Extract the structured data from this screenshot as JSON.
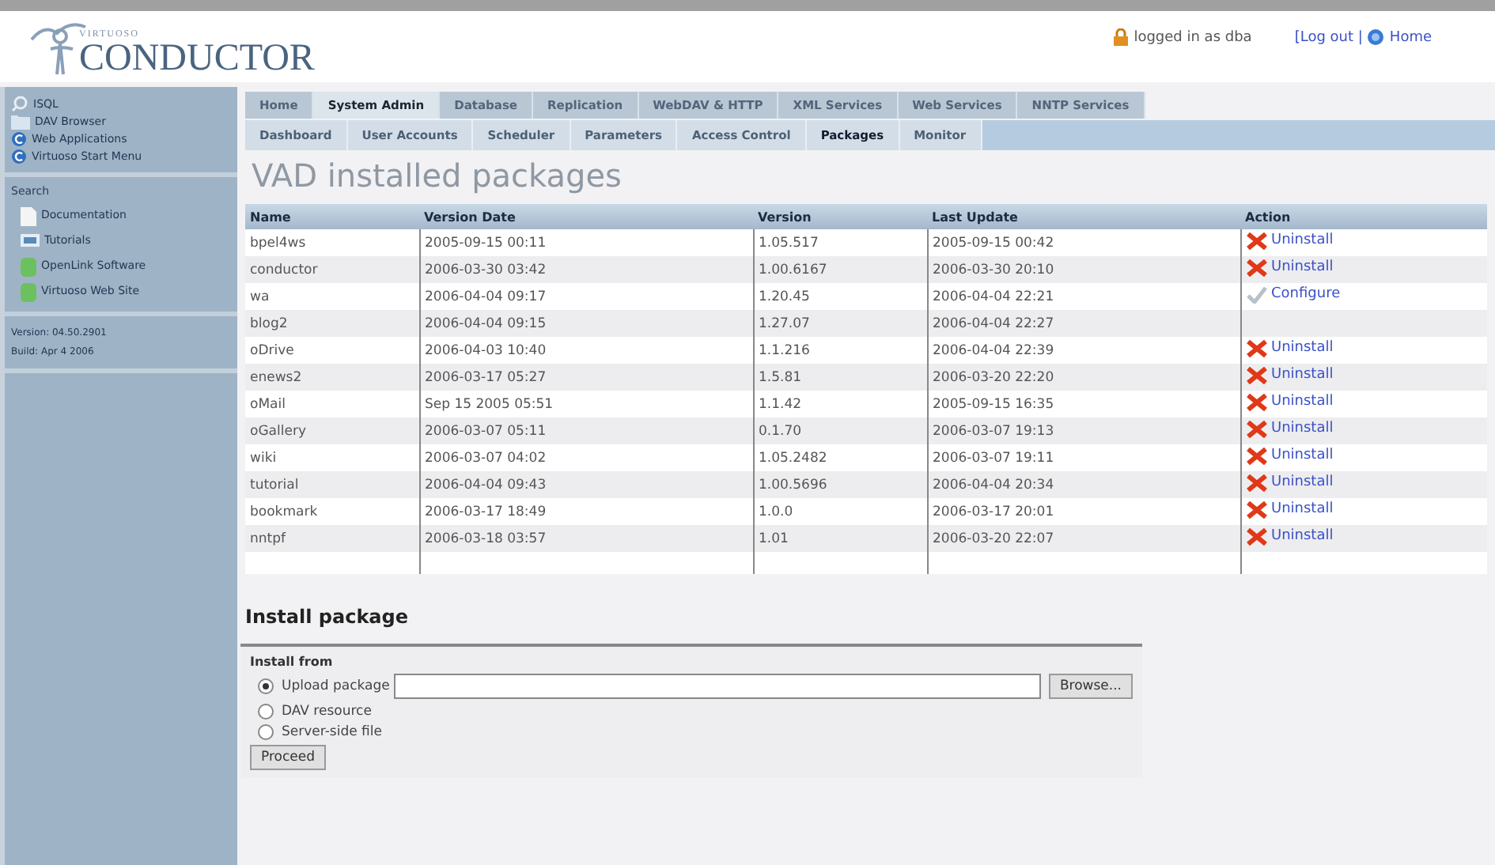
{
  "header": {
    "logo_small": "VIRTUOSO",
    "logo_big": "CONDUCTOR",
    "user": "logged in as dba",
    "logout": "[Log out |",
    "home": "Home"
  },
  "sidebar": {
    "groups": [
      {
        "items": [
          {
            "label": "ISQL",
            "kind": "isql"
          },
          {
            "label": "DAV Browser",
            "kind": "folder"
          },
          {
            "label": "Web Applications",
            "kind": "app"
          },
          {
            "label": "Virtuoso Start Menu",
            "kind": "app"
          }
        ]
      },
      {
        "title": "Search",
        "items": [
          {
            "label": "Documentation",
            "kind": "doc"
          },
          {
            "label": "Tutorials",
            "kind": "monitor"
          },
          {
            "label": "OpenLink Software",
            "kind": "site"
          },
          {
            "label": "Virtuoso Web Site",
            "kind": "site"
          }
        ]
      },
      {
        "info": [
          "Version: 04.50.2901",
          "Build: Apr 4 2006"
        ]
      }
    ]
  },
  "tabs": [
    {
      "label": "Home",
      "selected": false
    },
    {
      "label": "System Admin",
      "selected": true
    },
    {
      "label": "Database",
      "selected": false
    },
    {
      "label": "Replication",
      "selected": false
    },
    {
      "label": "WebDAV & HTTP",
      "selected": false
    },
    {
      "label": "XML Services",
      "selected": false
    },
    {
      "label": "Web Services",
      "selected": false
    },
    {
      "label": "NNTP Services",
      "selected": false
    }
  ],
  "subtabs": [
    {
      "label": "Dashboard",
      "selected": false
    },
    {
      "label": "User Accounts",
      "selected": false
    },
    {
      "label": "Scheduler",
      "selected": false
    },
    {
      "label": "Parameters",
      "selected": false
    },
    {
      "label": "Access Control",
      "selected": false
    },
    {
      "label": "Packages",
      "selected": true
    },
    {
      "label": "Monitor",
      "selected": false
    }
  ],
  "page_title": "VAD installed packages",
  "table": {
    "columns": [
      "Name",
      "Version Date",
      "Version",
      "Last Update",
      "Action"
    ],
    "rows": [
      {
        "name": "bpel4ws",
        "date": "2005-09-15 00:11",
        "version": "1.05.517",
        "updated": "2005-09-15 00:42",
        "action": {
          "kind": "uninstall",
          "label": "Uninstall"
        }
      },
      {
        "name": "conductor",
        "date": "2006-03-30 03:42",
        "version": "1.00.6167",
        "updated": "2006-03-30 20:10",
        "action": {
          "kind": "uninstall",
          "label": "Uninstall"
        }
      },
      {
        "name": "wa",
        "date": "2006-04-04 09:17",
        "version": "1.20.45",
        "updated": "2006-04-04 22:21",
        "action": {
          "kind": "configure",
          "label": "Configure"
        }
      },
      {
        "name": "blog2",
        "date": "2006-04-04 09:15",
        "version": "1.27.07",
        "updated": "2006-04-04 22:27"
      },
      {
        "name": "oDrive",
        "date": "2006-04-03 10:40",
        "version": "1.1.216",
        "updated": "2006-04-04 22:39",
        "action": {
          "kind": "uninstall",
          "label": "Uninstall"
        }
      },
      {
        "name": "enews2",
        "date": "2006-03-17 05:27",
        "version": "1.5.81",
        "updated": "2006-03-20 22:20",
        "action": {
          "kind": "uninstall",
          "label": "Uninstall"
        }
      },
      {
        "name": "oMail",
        "date": "Sep 15 2005 05:51",
        "version": "1.1.42",
        "updated": "2005-09-15 16:35",
        "action": {
          "kind": "uninstall",
          "label": "Uninstall"
        }
      },
      {
        "name": "oGallery",
        "date": "2006-03-07 05:11",
        "version": "0.1.70",
        "updated": "2006-03-07 19:13",
        "action": {
          "kind": "uninstall",
          "label": "Uninstall"
        }
      },
      {
        "name": "wiki",
        "date": "2006-03-07 04:02",
        "version": "1.05.2482",
        "updated": "2006-03-07 19:11",
        "action": {
          "kind": "uninstall",
          "label": "Uninstall"
        }
      },
      {
        "name": "tutorial",
        "date": "2006-04-04 09:43",
        "version": "1.00.5696",
        "updated": "2006-04-04 20:34",
        "action": {
          "kind": "uninstall",
          "label": "Uninstall"
        }
      },
      {
        "name": "bookmark",
        "date": "2006-03-17 18:49",
        "version": "1.0.0",
        "updated": "2006-03-17 20:01",
        "action": {
          "kind": "uninstall",
          "label": "Uninstall"
        }
      },
      {
        "name": "nntpf",
        "date": "2006-03-18 03:57",
        "version": "1.01",
        "updated": "2006-03-20 22:07",
        "action": {
          "kind": "uninstall",
          "label": "Uninstall"
        }
      }
    ]
  },
  "install": {
    "heading": "Install package",
    "legend": "Install from",
    "options": [
      {
        "label": "Upload package",
        "selected": true,
        "kind": "file"
      },
      {
        "label": "DAV resource",
        "selected": false
      },
      {
        "label": "Server-side file",
        "selected": false
      }
    ],
    "browse": "Browse...",
    "proceed": "Proceed"
  }
}
